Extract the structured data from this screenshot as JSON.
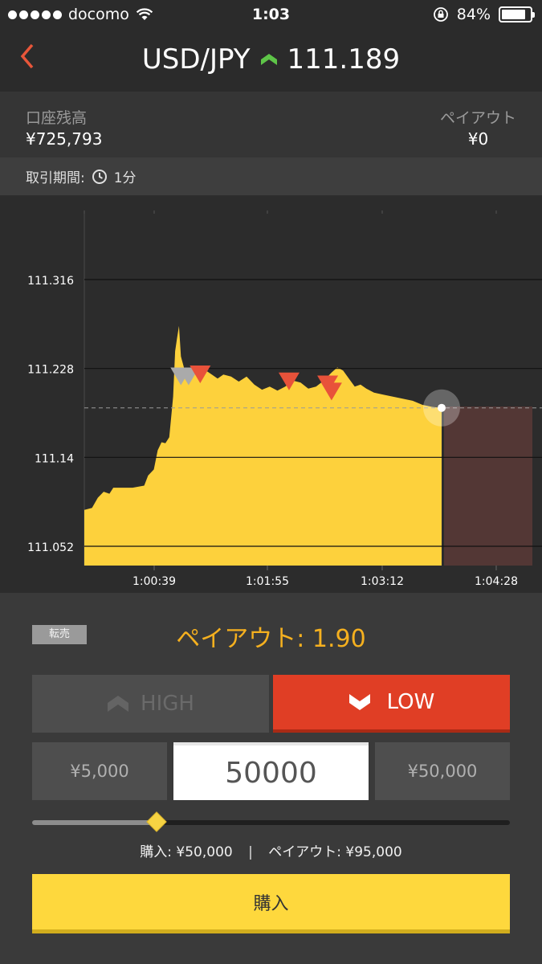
{
  "status_bar": {
    "carrier": "docomo",
    "time": "1:03",
    "battery": "84%",
    "battery_level": 0.84
  },
  "header": {
    "pair": "USD/JPY",
    "rate": "111.189",
    "trend_icon": "up-chevron-icon",
    "back_icon": "back-chevron-icon"
  },
  "account": {
    "balance_label": "口座残高",
    "balance_value": "¥725,793",
    "payout_label": "ペイアウト",
    "payout_value": "¥0"
  },
  "period": {
    "label": "取引期間:",
    "value": "1分",
    "icon": "clock-icon"
  },
  "chart_data": {
    "type": "area",
    "y_ticks": [
      "111.316",
      "111.228",
      "111.14",
      "111.052"
    ],
    "x_ticks": [
      "1:00:39",
      "1:01:55",
      "1:03:12",
      "1:04:28"
    ],
    "ylim": [
      111.03,
      111.38
    ],
    "current_rate": 111.189,
    "fill_color": "#fdd13c",
    "expiry_zone_color": "#5a3a37",
    "series": [
      {
        "t": 0.0,
        "v": 111.088
      },
      {
        "t": 4.0,
        "v": 111.09
      },
      {
        "t": 7.0,
        "v": 111.1
      },
      {
        "t": 10.0,
        "v": 111.106
      },
      {
        "t": 13.0,
        "v": 111.104
      },
      {
        "t": 15.0,
        "v": 111.11
      },
      {
        "t": 20.0,
        "v": 111.11
      },
      {
        "t": 25.0,
        "v": 111.11
      },
      {
        "t": 31.0,
        "v": 111.112
      },
      {
        "t": 33.0,
        "v": 111.122
      },
      {
        "t": 36.0,
        "v": 111.128
      },
      {
        "t": 38.0,
        "v": 111.147
      },
      {
        "t": 40.0,
        "v": 111.155
      },
      {
        "t": 42.0,
        "v": 111.154
      },
      {
        "t": 44.0,
        "v": 111.16
      },
      {
        "t": 46.0,
        "v": 111.2
      },
      {
        "t": 47.0,
        "v": 111.245
      },
      {
        "t": 48.0,
        "v": 111.258
      },
      {
        "t": 49.0,
        "v": 111.27
      },
      {
        "t": 50.0,
        "v": 111.24
      },
      {
        "t": 52.0,
        "v": 111.226
      },
      {
        "t": 54.0,
        "v": 111.224
      },
      {
        "t": 57.0,
        "v": 111.226
      },
      {
        "t": 60.0,
        "v": 111.221
      },
      {
        "t": 63.0,
        "v": 111.226
      },
      {
        "t": 66.0,
        "v": 111.222
      },
      {
        "t": 69.0,
        "v": 111.218
      },
      {
        "t": 72.0,
        "v": 111.222
      },
      {
        "t": 76.0,
        "v": 111.22
      },
      {
        "t": 80.0,
        "v": 111.215
      },
      {
        "t": 84.0,
        "v": 111.22
      },
      {
        "t": 88.0,
        "v": 111.212
      },
      {
        "t": 92.0,
        "v": 111.207
      },
      {
        "t": 96.0,
        "v": 111.21
      },
      {
        "t": 100.0,
        "v": 111.206
      },
      {
        "t": 104.0,
        "v": 111.21
      },
      {
        "t": 108.0,
        "v": 111.216
      },
      {
        "t": 112.0,
        "v": 111.214
      },
      {
        "t": 116.0,
        "v": 111.208
      },
      {
        "t": 120.0,
        "v": 111.21
      },
      {
        "t": 124.0,
        "v": 111.216
      },
      {
        "t": 128.0,
        "v": 111.224
      },
      {
        "t": 131.0,
        "v": 111.229
      },
      {
        "t": 134.0,
        "v": 111.226
      },
      {
        "t": 137.0,
        "v": 111.218
      },
      {
        "t": 140.0,
        "v": 111.21
      },
      {
        "t": 143.0,
        "v": 111.212
      },
      {
        "t": 146.0,
        "v": 111.208
      },
      {
        "t": 150.0,
        "v": 111.204
      },
      {
        "t": 155.0,
        "v": 111.202
      },
      {
        "t": 160.0,
        "v": 111.2
      },
      {
        "t": 165.0,
        "v": 111.198
      },
      {
        "t": 170.0,
        "v": 111.196
      },
      {
        "t": 175.0,
        "v": 111.192
      },
      {
        "t": 180.0,
        "v": 111.19
      },
      {
        "t": 185.0,
        "v": 111.189
      }
    ],
    "trade_markers": [
      {
        "t": 50.0,
        "v": 111.221,
        "state": "inactive"
      },
      {
        "t": 54.0,
        "v": 111.221,
        "state": "inactive"
      },
      {
        "t": 60.0,
        "v": 111.223,
        "state": "low"
      },
      {
        "t": 106.0,
        "v": 111.216,
        "state": "low"
      },
      {
        "t": 126.0,
        "v": 111.213,
        "state": "low"
      },
      {
        "t": 128.0,
        "v": 111.206,
        "state": "low"
      }
    ],
    "marker_colors": {
      "inactive": "#aaaaaa",
      "low": "#e8523a"
    }
  },
  "controls": {
    "resell_label": "転売",
    "payout_rate_text": "ペイアウト: 1.90",
    "high_label": "HIGH",
    "low_label": "LOW",
    "high_icon": "up-chevron-icon",
    "low_icon": "down-chevron-icon",
    "min_amount": "¥5,000",
    "amount_value": "50000",
    "max_amount": "¥50,000",
    "slider_level": 0.26,
    "summary_purchase": "購入: ¥50,000",
    "summary_sep": "|",
    "summary_payout": "ペイアウト: ¥95,000",
    "buy_label": "購入"
  }
}
